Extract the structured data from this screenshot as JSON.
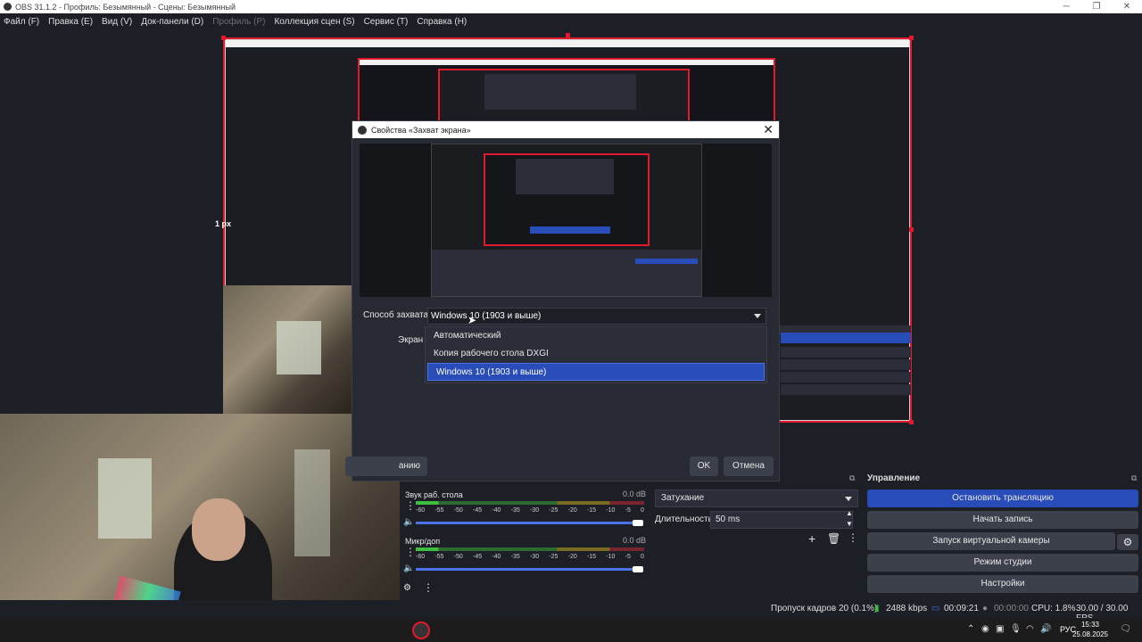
{
  "window": {
    "title": "OBS 31.1.2 - Профиль: Безымянный - Сцены: Безымянный"
  },
  "menu": [
    {
      "label": "Файл (F)",
      "enabled": true
    },
    {
      "label": "Правка (E)",
      "enabled": true
    },
    {
      "label": "Вид (V)",
      "enabled": true
    },
    {
      "label": "Док-панели (D)",
      "enabled": true
    },
    {
      "label": "Профиль (P)",
      "enabled": false
    },
    {
      "label": "Коллекция сцен (S)",
      "enabled": true
    },
    {
      "label": "Сервис (T)",
      "enabled": true
    },
    {
      "label": "Справка (H)",
      "enabled": true
    }
  ],
  "preview": {
    "size_label": "1 px"
  },
  "dialog": {
    "title": "Свойства «Захват экрана»",
    "capture_method_label": "Способ захвата",
    "capture_method_value": "Windows 10 (1903 и выше)",
    "screen_label": "Экран",
    "options": [
      "Автоматический",
      "Копия рабочего стола DXGI",
      "Windows 10 (1903 и выше)"
    ],
    "selected_option": 2,
    "defaults_button": "анию",
    "ok_button": "OK",
    "cancel_button": "Отмена"
  },
  "audio": {
    "channels": [
      {
        "name": "Звук раб. стола",
        "level": "0.0 dB"
      },
      {
        "name": "Микр/доп",
        "level": "0.0 dB"
      }
    ],
    "ticks": [
      "-60",
      "-55",
      "-50",
      "-45",
      "-40",
      "-35",
      "-30",
      "-25",
      "-20",
      "-15",
      "-10",
      "-5",
      "0"
    ]
  },
  "transitions": {
    "type": "Затухание",
    "duration_label": "Длительность",
    "duration_value": "50 ms"
  },
  "controls": {
    "header": "Управление",
    "stop_stream": "Остановить трансляцию",
    "start_record": "Начать запись",
    "virtual_cam": "Запуск виртуальной камеры",
    "studio_mode": "Режим студии",
    "settings": "Настройки"
  },
  "status": {
    "dropped_frames": "Пропуск кадров 20 (0.1%)",
    "bitrate": "2488 kbps",
    "stream_time": "00:09:21",
    "record_time": "00:00:00",
    "cpu": "CPU: 1.8%",
    "fps": "30.00 / 30.00 FPS"
  },
  "taskbar": {
    "language": "РУС",
    "time": "15:33",
    "date": "25.08.2025"
  },
  "colors": {
    "accent": "#284cb8",
    "selection_border": "#e2192c",
    "background": "#1d1f26"
  }
}
